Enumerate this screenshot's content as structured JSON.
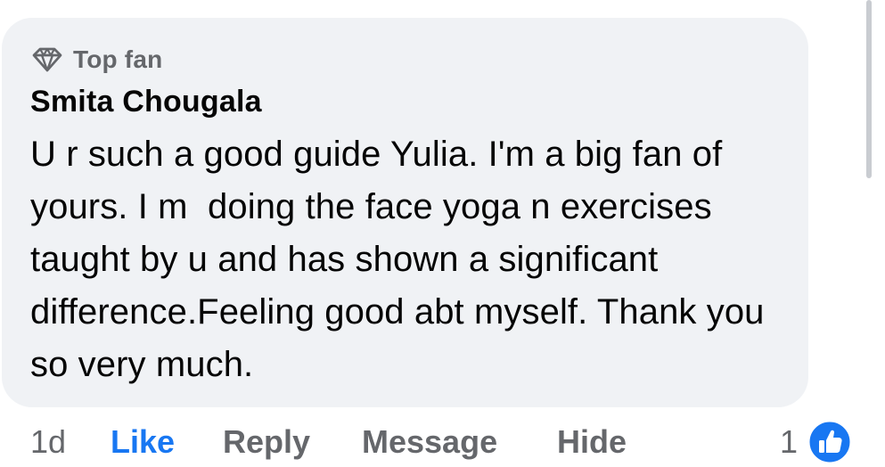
{
  "comment": {
    "badge": {
      "icon": "diamond-icon",
      "label": "Top fan"
    },
    "author": "Smita Chougala",
    "text": "U r such a good guide Yulia. I'm a big fan of yours. I m  doing the face yoga n exercises taught by u and has shown a significant difference.Feeling good abt myself. Thank you so very much."
  },
  "actions": {
    "timestamp": "1d",
    "like": "Like",
    "reply": "Reply",
    "message": "Message",
    "hide": "Hide"
  },
  "reactions": {
    "count": "1",
    "icon": "like-thumb-icon"
  },
  "colors": {
    "bubble": "#f0f2f5",
    "accent": "#1877f2",
    "muted": "#65676b",
    "text": "#050505"
  }
}
